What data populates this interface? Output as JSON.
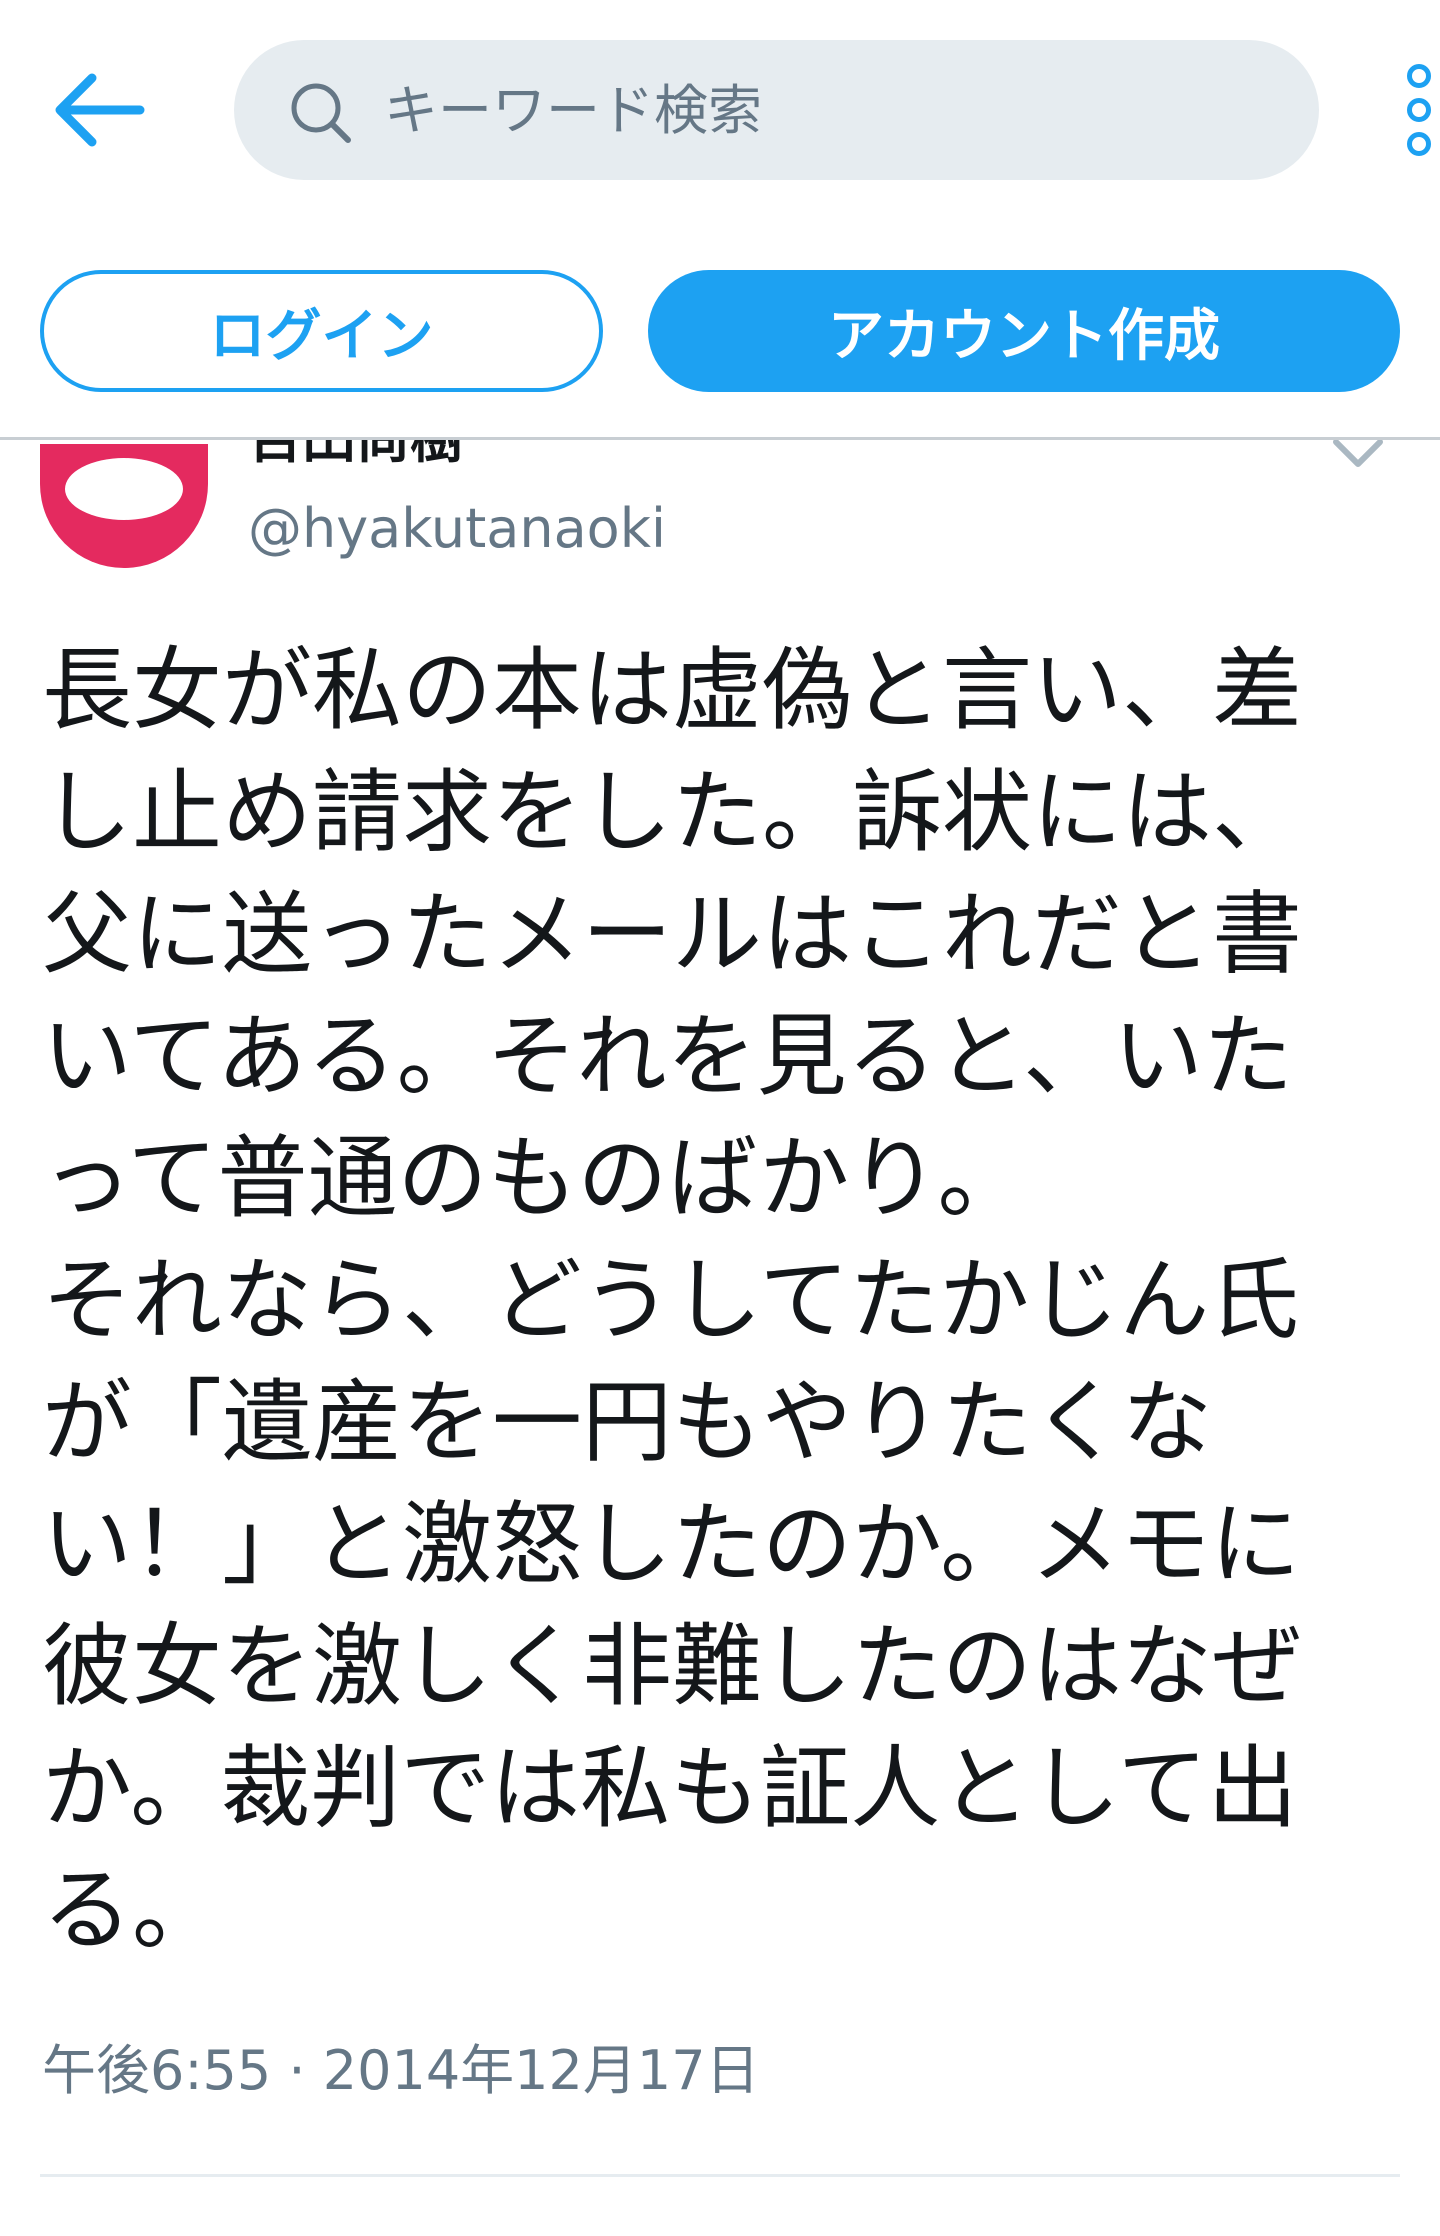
{
  "colors": {
    "accent": "#1da1f2",
    "search_bg": "#e6ecf0",
    "secondary_text": "#657786",
    "primary_text": "#14171a",
    "avatar_bg": "#e42a5f"
  },
  "header": {
    "back_icon": "arrow-left-icon",
    "search": {
      "icon": "search-icon",
      "placeholder": "キーワード検索"
    },
    "more_icon": "vertical-dots-icon"
  },
  "actions": {
    "login_label": "ログイン",
    "signup_label": "アカウント作成"
  },
  "tweet": {
    "display_name": "百田尚樹",
    "username": "@hyakutanaoki",
    "menu_icon": "chevron-down-icon",
    "text_lines": [
      "長女が私の本は虚偽と言い、差",
      "し止め請求をした。訴状には、",
      "父に送ったメールはこれだと書",
      "いてある。それを見ると、いた",
      "って普通のものばかり。",
      "それなら、どうしてたかじん氏",
      "が「遺産を一円もやりたくな",
      "い！」と激怒したのか。メモに",
      "彼女を激しく非難したのはなぜ",
      "か。裁判では私も証人として出",
      "る。"
    ],
    "timestamp": "午後6:55 · 2014年12月17日"
  }
}
